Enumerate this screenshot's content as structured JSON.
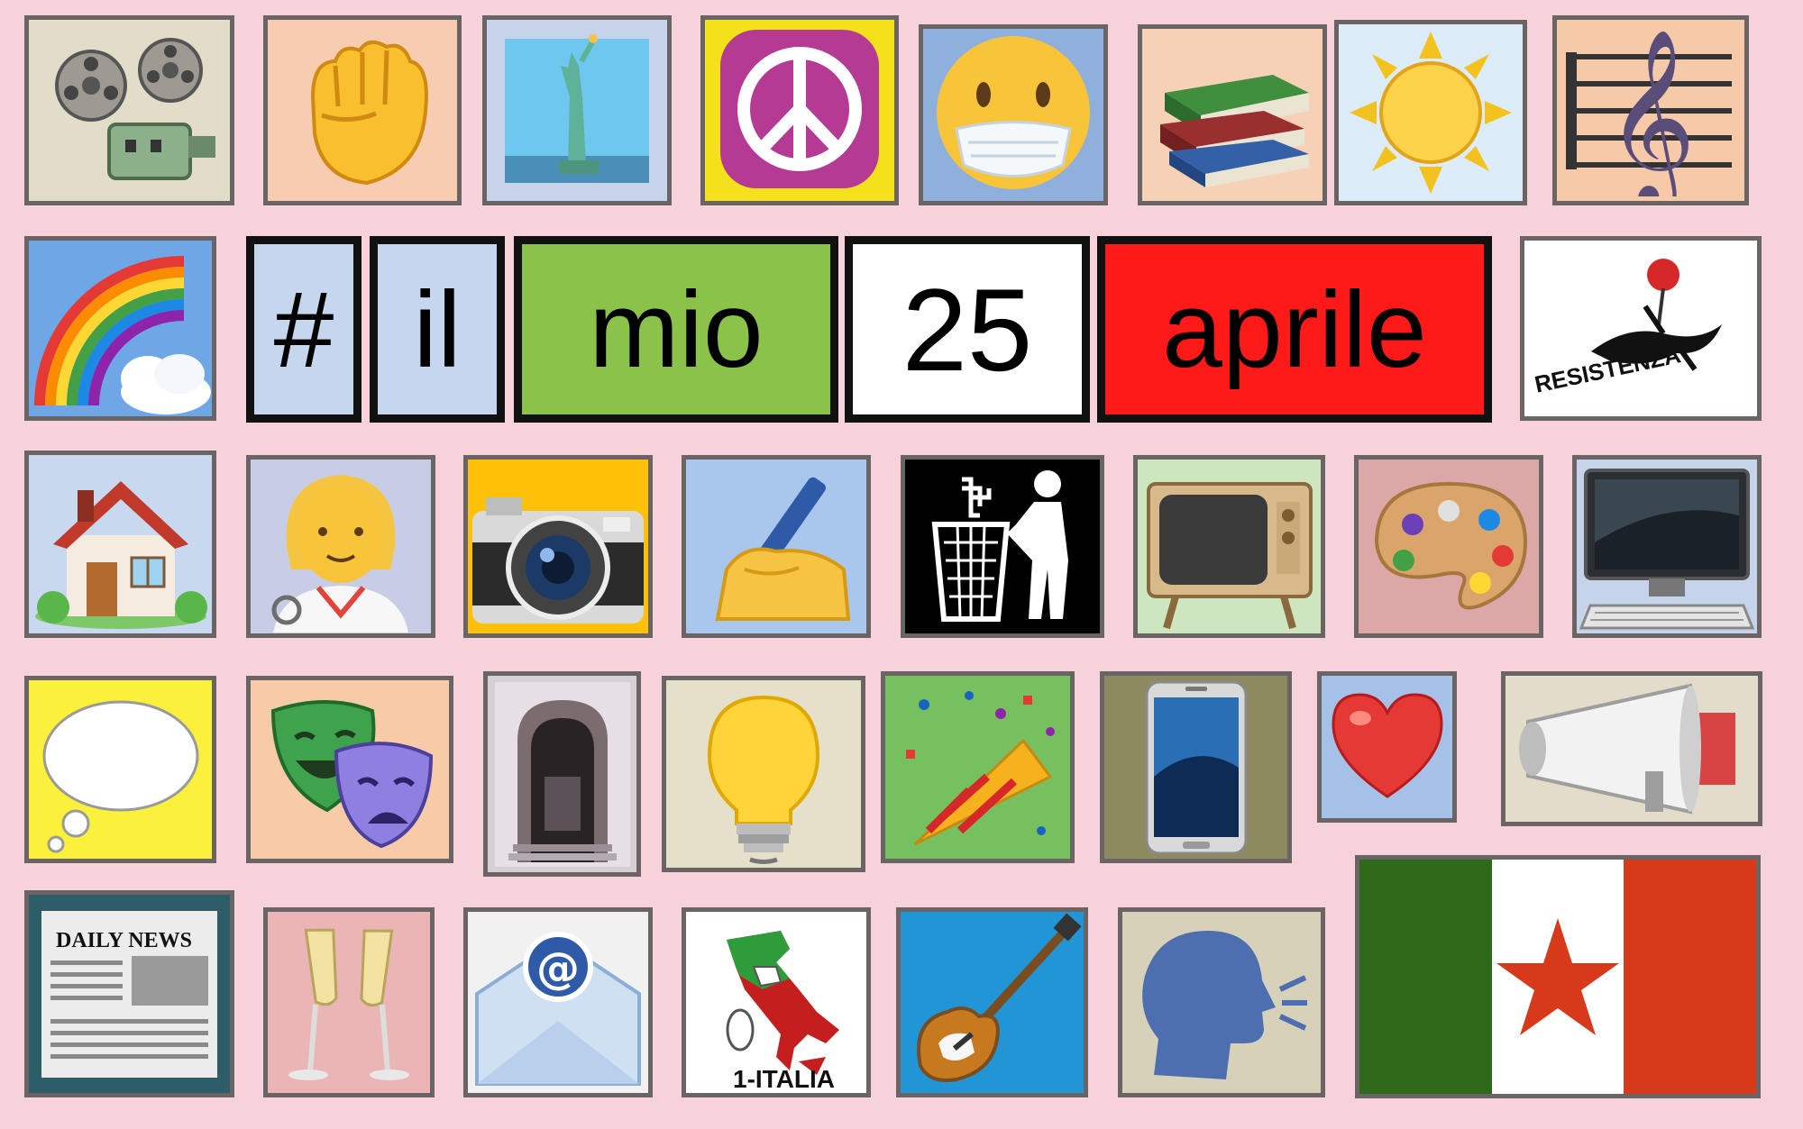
{
  "title_words": [
    "#",
    "il",
    "mio",
    "25",
    "aprile"
  ],
  "resistenza_caption": "RESISTENZA",
  "newspaper_caption": "DAILY NEWS",
  "italia_caption": "1-ITALIA",
  "colors": {
    "background": "#f7d2da",
    "word_blue": "#c6d6ee",
    "word_green": "#8bc34a",
    "word_white": "#ffffff",
    "word_red": "#ff1a1a",
    "flag_green": "#2f6a1a",
    "flag_red": "#d73a1a"
  },
  "icons": [
    "film-projector-icon",
    "raised-fist-icon",
    "statue-of-liberty-icon",
    "peace-symbol-icon",
    "face-with-medical-mask-icon",
    "books-icon",
    "sun-icon",
    "treble-clef-icon",
    "rainbow-icon",
    "resistenza-logo-icon",
    "house-icon",
    "woman-doctor-icon",
    "camera-icon",
    "writing-hand-icon",
    "trash-swastika-icon",
    "television-icon",
    "palette-icon",
    "computer-icon",
    "thought-bubble-icon",
    "theater-masks-icon",
    "doorway-icon",
    "light-bulb-icon",
    "party-popper-icon",
    "smartphone-icon",
    "heart-icon",
    "megaphone-icon",
    "newspaper-icon",
    "champagne-glasses-icon",
    "email-icon",
    "italy-map-icon",
    "electric-guitar-icon",
    "speaking-head-icon",
    "flag-with-star-icon"
  ]
}
